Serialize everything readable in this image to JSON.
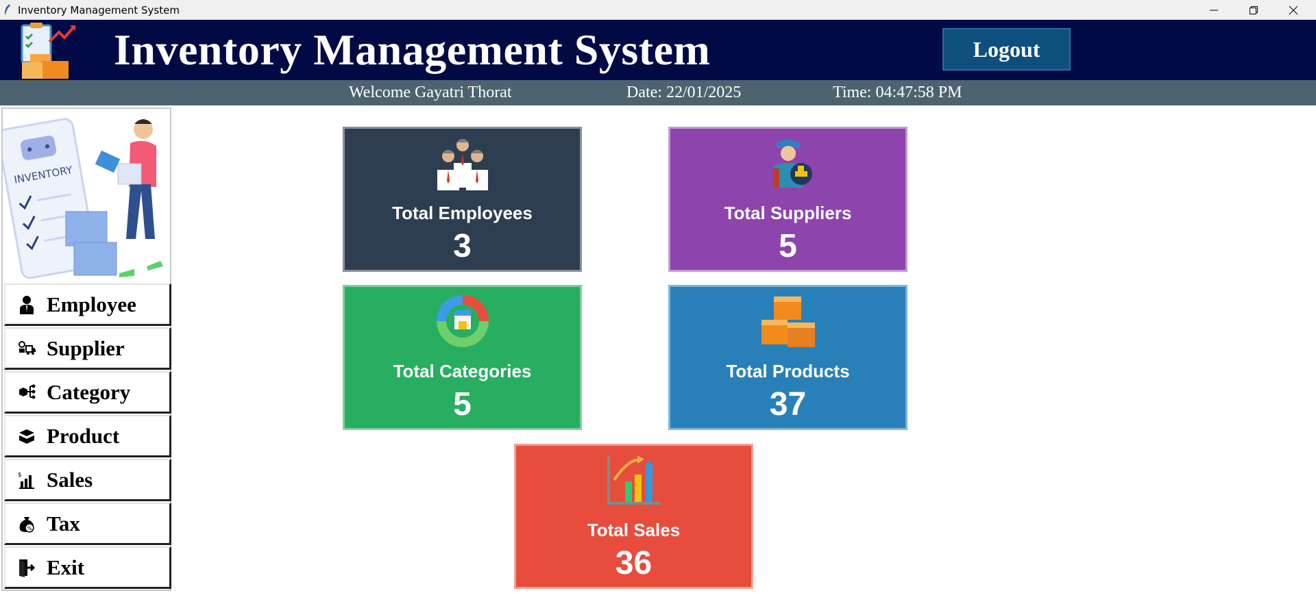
{
  "window": {
    "title": "Inventory Management System"
  },
  "header": {
    "title": "Inventory Management System",
    "logout_label": "Logout"
  },
  "subheader": {
    "welcome": "Welcome Gayatri Thorat",
    "date": "Date: 22/01/2025",
    "time": "Time: 04:47:58 PM"
  },
  "sidebar": {
    "illustration_text": "INVENTORY",
    "items": [
      {
        "label": "Employee",
        "icon": "employee-icon"
      },
      {
        "label": "Supplier",
        "icon": "supplier-icon"
      },
      {
        "label": "Category",
        "icon": "category-icon"
      },
      {
        "label": "Product",
        "icon": "product-icon"
      },
      {
        "label": "Sales",
        "icon": "sales-icon"
      },
      {
        "label": "Tax",
        "icon": "tax-icon"
      },
      {
        "label": "Exit",
        "icon": "exit-icon"
      }
    ]
  },
  "cards": [
    {
      "label": "Total Employees",
      "value": "3",
      "color": "#2c3e50",
      "icon": "employees-icon"
    },
    {
      "label": "Total Suppliers",
      "value": "5",
      "color": "#8e44ad",
      "icon": "suppliers-icon"
    },
    {
      "label": "Total Categories",
      "value": "5",
      "color": "#27ae60",
      "icon": "categories-icon"
    },
    {
      "label": "Total Products",
      "value": "37",
      "color": "#2980b9",
      "icon": "products-icon"
    },
    {
      "label": "Total Sales",
      "value": "36",
      "color": "#e74c3c",
      "icon": "sales-chart-icon"
    }
  ],
  "colors": {
    "header_bg": "#020a45",
    "subheader_bg": "#4d636f",
    "logout_bg": "#0e4f7e"
  }
}
